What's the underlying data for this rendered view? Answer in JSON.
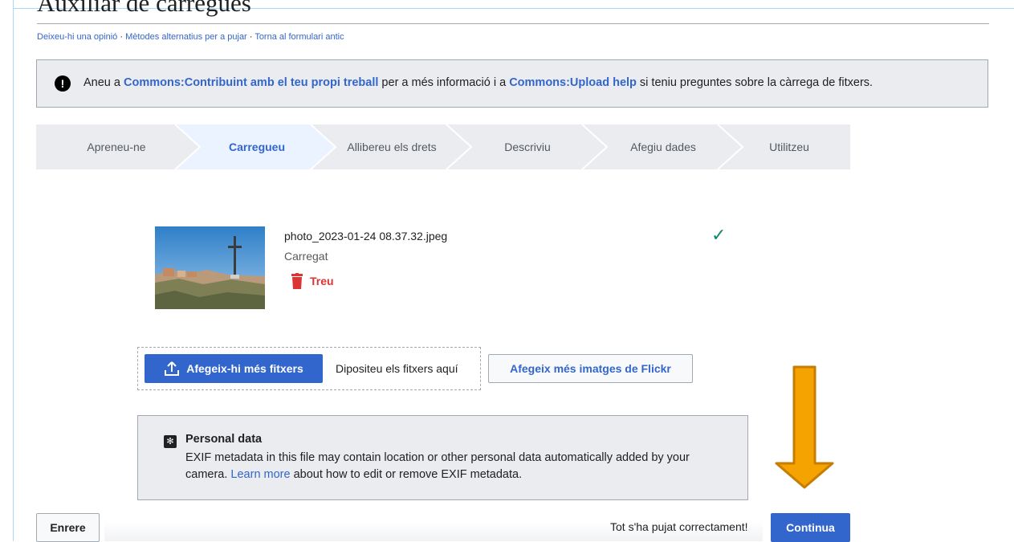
{
  "page": {
    "title": "Auxiliar de càrregues"
  },
  "links": {
    "feedback": "Deixeu-hi una opinió",
    "alt_methods": "Mètodes alternatius per a pujar",
    "old_form": "Torna al formulari antic",
    "separator": " · "
  },
  "notice": {
    "prefix": "Aneu a ",
    "link1": "Commons:Contribuint amb el teu propi treball",
    "middle": " per a més informació i a ",
    "link2": "Commons:Upload help",
    "suffix": " si teniu preguntes sobre la càrrega de fitxers."
  },
  "steps": [
    {
      "label": "Apreneu-ne",
      "active": false
    },
    {
      "label": "Carregueu",
      "active": true
    },
    {
      "label": "Allibereu els drets",
      "active": false
    },
    {
      "label": "Descriviu",
      "active": false
    },
    {
      "label": "Afegiu dades",
      "active": false
    },
    {
      "label": "Utilitzeu",
      "active": false
    }
  ],
  "file": {
    "name": "photo_2023-01-24 08.37.32.jpeg",
    "status": "Carregat",
    "remove_label": "Treu",
    "check": "✓"
  },
  "upload": {
    "add_more_label": "Afegeix-hi més fitxers",
    "drop_text": "Dipositeu els fitxers aquí",
    "flickr_label": "Afegeix més imatges de Flickr"
  },
  "personal_data": {
    "title": "Personal data",
    "body_before": "EXIF metadata in this file may contain location or other personal data automatically added by your camera. ",
    "learn_more": "Learn more",
    "body_after": " about how to edit or remove EXIF metadata."
  },
  "footer": {
    "back_label": "Enrere",
    "success_text": "Tot s'ha pujat correctament!",
    "continue_label": "Continua"
  },
  "colors": {
    "accent": "#3366cc",
    "arrow_fill": "#f5a300",
    "arrow_stroke": "#c77d00",
    "success_check": "#14866d",
    "remove": "#dd3333"
  }
}
